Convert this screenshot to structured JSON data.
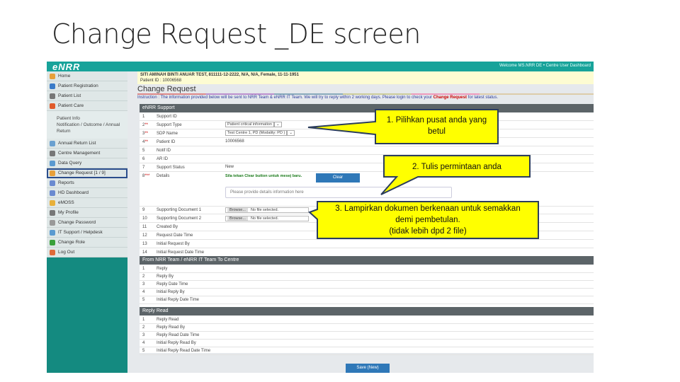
{
  "slide_title": "Change Request _DE screen",
  "app": {
    "logo": "eNRR",
    "welcome": "Welcome MS.NRR DE • Centre User Dashboard"
  },
  "sidebar": {
    "items": [
      {
        "label": "Home",
        "color": "#e8a03a"
      },
      {
        "label": "Patient Registration",
        "color": "#3a7bc8"
      },
      {
        "label": "Patient List",
        "color": "#777"
      },
      {
        "label": "Patient Care",
        "color": "#e05a2a"
      }
    ],
    "sub_items": [
      "Patient Info",
      "Notification / Outcome / Annual Return"
    ],
    "items2": [
      {
        "label": "Annual Return List",
        "color": "#6aa0d0"
      },
      {
        "label": "Centre Management",
        "color": "#777"
      },
      {
        "label": "Data Query",
        "color": "#5a9ad0"
      },
      {
        "label": "Change Request [1 / 9]",
        "color": "#e8a03a"
      },
      {
        "label": "Reports",
        "color": "#6a8ad0"
      },
      {
        "label": "HD Dashboard",
        "color": "#6a8ad0"
      },
      {
        "label": "eMOSS",
        "color": "#e8b03a"
      },
      {
        "label": "My Profile",
        "color": "#777"
      },
      {
        "label": "Change Password",
        "color": "#999"
      },
      {
        "label": "IT Support / Helpdesk",
        "color": "#5a9ad0"
      },
      {
        "label": "Change Role",
        "color": "#3aa03a"
      },
      {
        "label": "Log Out",
        "color": "#e06a3a"
      }
    ]
  },
  "patient": {
    "line1": "SITI AMINAH BINTI ANUAR TEST, 811111-12-2222, N/A, N/A, Female, 11-11-1951",
    "line2": "Patient ID : 10006568"
  },
  "page_title": "Change Request",
  "instruction": {
    "text": "Instruction : The information provided below will be sent to NRR Team & eNRR IT Team. We will try to reply within 2 working days. Please login to check your ",
    "link": "Change Request",
    "tail": " for latest status."
  },
  "section1": "eNRR Support",
  "form": [
    {
      "n": "1",
      "req": "",
      "label": "Support ID",
      "value": ""
    },
    {
      "n": "2",
      "req": "**",
      "label": "Support Type",
      "value": "Patient critical information"
    },
    {
      "n": "3",
      "req": "**",
      "label": "SDP Name",
      "value": "Test Centre 1, PD (Modality: PD )"
    },
    {
      "n": "4",
      "req": "**",
      "label": "Patient ID",
      "value": "10006568"
    },
    {
      "n": "5",
      "req": "",
      "label": "Notif ID",
      "value": ""
    },
    {
      "n": "6",
      "req": "",
      "label": "AR ID",
      "value": ""
    },
    {
      "n": "7",
      "req": "",
      "label": "Support Status",
      "value": "New"
    },
    {
      "n": "8",
      "req": "***",
      "label": "Details",
      "value": "Sila tekan Clear button untuk mesej baru."
    }
  ],
  "clear_label": "Clear",
  "details_placeholder": "Please provide details information here",
  "docs": [
    {
      "n": "9",
      "label": "Supporting Document 1",
      "browse": "Browse...",
      "status": "No file selected."
    },
    {
      "n": "10",
      "label": "Supporting Document 2",
      "browse": "Browse...",
      "status": "No file selected."
    }
  ],
  "form2": [
    {
      "n": "11",
      "label": "Created By"
    },
    {
      "n": "12",
      "label": "Request Date Time"
    },
    {
      "n": "13",
      "label": "Initial Request By"
    },
    {
      "n": "14",
      "label": "Initial Request Date Time"
    }
  ],
  "section2": "From NRR Team / eNRR IT Team To Centre",
  "reply": [
    {
      "n": "1",
      "label": "Reply"
    },
    {
      "n": "2",
      "label": "Reply By"
    },
    {
      "n": "3",
      "label": "Reply Date Time"
    },
    {
      "n": "4",
      "label": "Initial Reply By"
    },
    {
      "n": "5",
      "label": "Initial Reply Date Time"
    }
  ],
  "section3": "Reply Read",
  "reply_read": [
    {
      "n": "1",
      "label": "Reply Read"
    },
    {
      "n": "2",
      "label": "Reply Read By"
    },
    {
      "n": "3",
      "label": "Reply Read Date Time"
    },
    {
      "n": "4",
      "label": "Initial Reply Read By"
    },
    {
      "n": "5",
      "label": "Initial Reply Read Date Time"
    }
  ],
  "save_label": "Save (New)",
  "callouts": [
    {
      "text": "1. Pilihkan pusat anda yang betul"
    },
    {
      "text": "2. Tulis permintaan anda"
    },
    {
      "line1": "3. Lampirkan dokumen berkenaan untuk semakkan",
      "line2": "demi pembetulan.",
      "line3": "(tidak lebih dpd 2 file)"
    }
  ]
}
